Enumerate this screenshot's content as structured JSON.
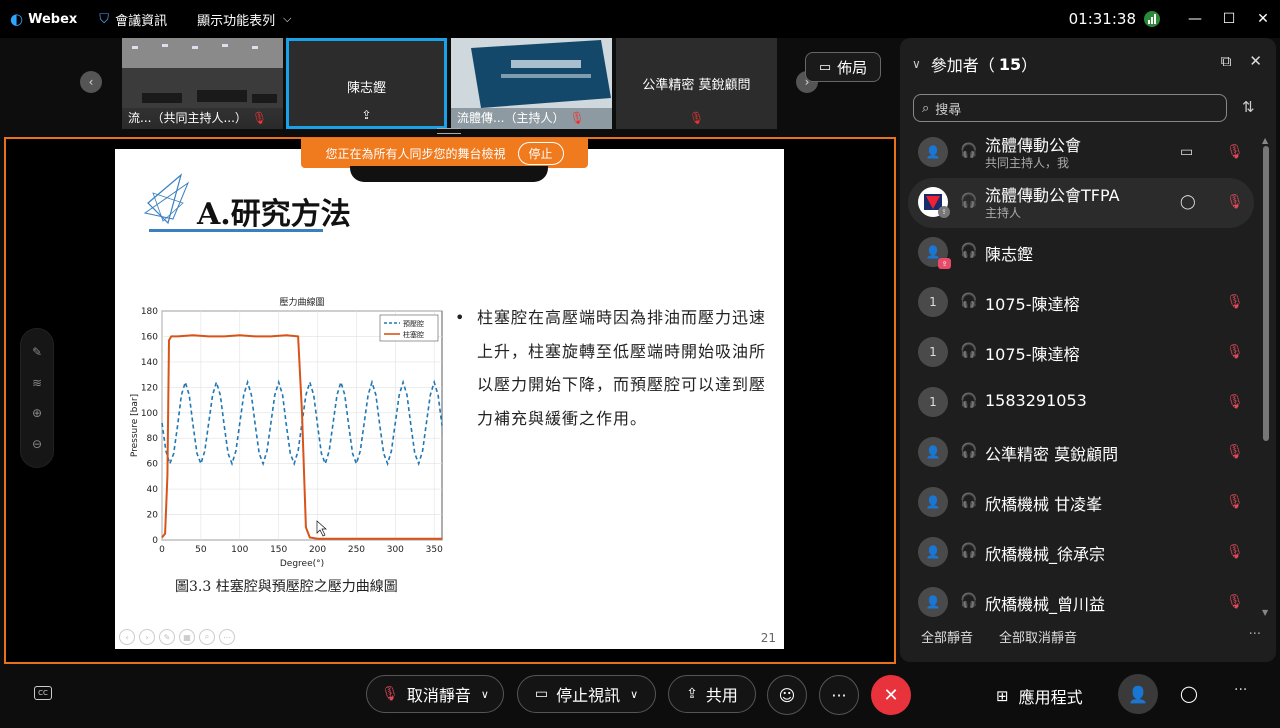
{
  "titlebar": {
    "app_name": "Webex",
    "meeting_info": "會議資訊",
    "view_menu": "顯示功能表列",
    "time": "01:31:38"
  },
  "filmstrip": {
    "tiles": [
      {
        "caption": "流...（共同主持人...）"
      },
      {
        "name": "陳志鏗"
      },
      {
        "caption": "流體傳...（主持人）"
      },
      {
        "name": "公準精密 莫銳顧問"
      }
    ],
    "layout_label": "佈局"
  },
  "share_banner": {
    "text": "您正在為所有人同步您的舞台檢視",
    "stop_label": "停止"
  },
  "slide": {
    "title": "A.研究方法",
    "bullet": "柱塞腔在高壓端時因為排油而壓力迅速上升，柱塞旋轉至低壓端時開始吸油所以壓力開始下降，而預壓腔可以達到壓力補充與緩衝之作用。",
    "caption": "圖3.3 柱塞腔與預壓腔之壓力曲線圖",
    "page_number": "21"
  },
  "chart_data": {
    "type": "line",
    "title": "壓力曲線圖",
    "xlabel": "Degree(°)",
    "ylabel": "Pressure [bar]",
    "xlim": [
      0,
      360
    ],
    "ylim": [
      0,
      180
    ],
    "xticks": [
      0,
      50,
      100,
      150,
      200,
      250,
      300,
      350
    ],
    "yticks": [
      0,
      20,
      40,
      60,
      80,
      100,
      120,
      140,
      160,
      180
    ],
    "grid": true,
    "legend_position": "top-right",
    "series": [
      {
        "name": "預壓腔",
        "color": "#1f77b4",
        "style": "dashed",
        "x": [
          0,
          5,
          10,
          15,
          20,
          25,
          30,
          35,
          40,
          45,
          50,
          55,
          60,
          65,
          70,
          75,
          80,
          85,
          90,
          95,
          100,
          105,
          110,
          115,
          120,
          125,
          130,
          135,
          140,
          145,
          150,
          155,
          160,
          165,
          170,
          175,
          180,
          185,
          190,
          195,
          200,
          205,
          210,
          215,
          220,
          225,
          230,
          235,
          240,
          245,
          250,
          255,
          260,
          265,
          270,
          275,
          280,
          285,
          290,
          295,
          300,
          305,
          310,
          315,
          320,
          325,
          330,
          335,
          340,
          345,
          350,
          355,
          360
        ],
        "y": [
          92,
          70,
          60,
          68,
          90,
          114,
          124,
          114,
          90,
          68,
          60,
          70,
          92,
          114,
          124,
          114,
          90,
          68,
          60,
          70,
          92,
          114,
          124,
          114,
          90,
          68,
          60,
          70,
          92,
          114,
          124,
          114,
          90,
          68,
          60,
          70,
          92,
          114,
          124,
          114,
          90,
          68,
          60,
          70,
          92,
          114,
          124,
          114,
          90,
          68,
          60,
          70,
          92,
          114,
          124,
          114,
          90,
          68,
          60,
          70,
          92,
          114,
          124,
          114,
          90,
          68,
          60,
          70,
          92,
          114,
          124,
          114,
          90
        ]
      },
      {
        "name": "柱塞腔",
        "color": "#d95319",
        "style": "solid",
        "x": [
          0,
          4,
          7,
          9,
          12,
          20,
          40,
          60,
          80,
          100,
          120,
          140,
          160,
          175,
          180,
          185,
          190,
          200,
          220,
          240,
          260,
          280,
          300,
          320,
          340,
          360
        ],
        "y": [
          2,
          5,
          50,
          157,
          160,
          160,
          161,
          160,
          160,
          161,
          160,
          160,
          161,
          160,
          100,
          10,
          2,
          1,
          1,
          1,
          1,
          1,
          1,
          1,
          1,
          1
        ]
      }
    ]
  },
  "annotation_tools": [
    {
      "icon": "pen-icon"
    },
    {
      "icon": "pointer-icon"
    },
    {
      "icon": "zoom-in-icon"
    },
    {
      "icon": "zoom-out-icon"
    }
  ],
  "participants_panel": {
    "title": "參加者（",
    "count": "15",
    "close_paren": "）",
    "search_placeholder": "搜尋",
    "mute_all": "全部靜音",
    "unmute_all": "全部取消靜音",
    "participants": [
      {
        "name": "流體傳動公會",
        "role": "共同主持人，我",
        "avatar": "",
        "camera": true,
        "muted": true
      },
      {
        "name": "流體傳動公會TFPA",
        "role": "主持人",
        "avatar": "logo",
        "chat": true,
        "muted": true
      },
      {
        "name": "陳志鏗",
        "role": "",
        "avatar": "",
        "muted": false
      },
      {
        "name": "1075-陳達榕",
        "role": "",
        "avatar": "1",
        "muted": true
      },
      {
        "name": "1075-陳達榕",
        "role": "",
        "avatar": "1",
        "muted": true
      },
      {
        "name": "1583291053",
        "role": "",
        "avatar": "1",
        "muted": true
      },
      {
        "name": "公準精密 莫銳顧問",
        "role": "",
        "avatar": "",
        "muted": true
      },
      {
        "name": "欣橋機械 甘凌峯",
        "role": "",
        "avatar": "",
        "muted": true
      },
      {
        "name": "欣橋機械_徐承宗",
        "role": "",
        "avatar": "",
        "muted": true
      },
      {
        "name": "欣橋機械_曾川益",
        "role": "",
        "avatar": "",
        "muted": true
      }
    ]
  },
  "controls": {
    "unmute": "取消靜音",
    "stop_video": "停止視訊",
    "share": "共用",
    "apps": "應用程式",
    "cc_label": "CC"
  }
}
